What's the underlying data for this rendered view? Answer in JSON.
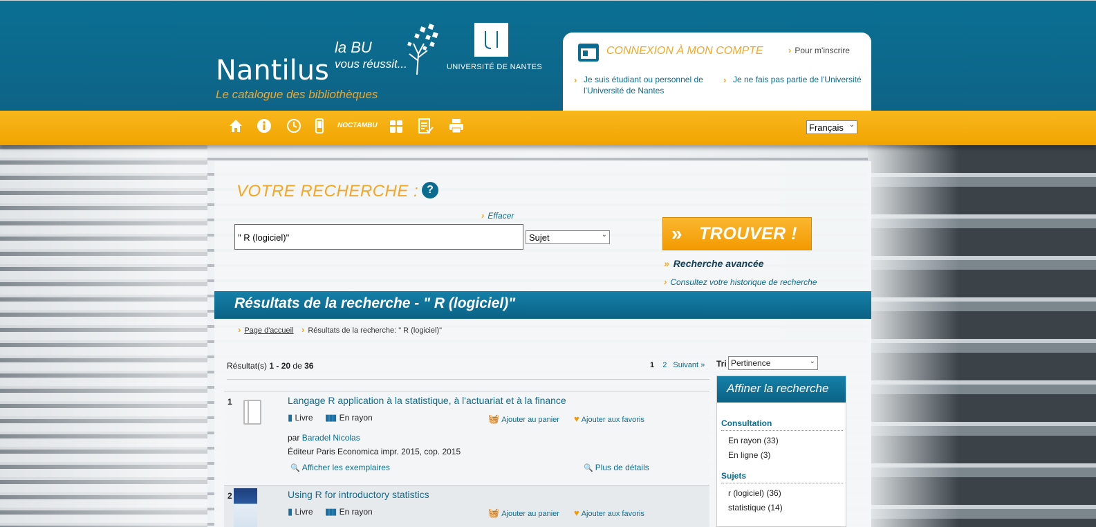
{
  "header": {
    "brand": "Nantilus",
    "tagline": "Le catalogue des bibliothèques",
    "labu_line1": "la BU",
    "labu_line2": "vous réussit...",
    "university": "UNIVERSITÉ DE NANTES",
    "account": {
      "title": "CONNEXION À MON COMPTE",
      "register": "Pour m'inscrire",
      "link_student": "Je suis étudiant ou personnel de l'Université de Nantes",
      "link_external": "Je ne fais pas partie de l'Université"
    }
  },
  "nav": {
    "icons": [
      "home-icon",
      "info-icon",
      "clock-icon",
      "mobile-icon",
      "noctambu-icon",
      "bottles-icon",
      "checklist-icon",
      "print-icon"
    ],
    "noctambu_label": "NOCTAMBU",
    "language": "Français"
  },
  "search": {
    "title": "VOTRE RECHERCHE :",
    "help": "?",
    "clear": "Effacer",
    "query": "\" R (logiciel)\"",
    "field": "Sujet",
    "find_button": "TROUVER !",
    "advanced": "Recherche avancée",
    "history": "Consultez votre historique de recherche"
  },
  "results": {
    "banner": "Résultats de la recherche - \" R (logiciel)\"",
    "breadcrumb_home": "Page d'accueil",
    "breadcrumb_current": "Résultats de la recherche: \" R (logiciel)\"",
    "count_prefix": "Résultat(s)",
    "count_range": "1 - 20",
    "count_of": "de",
    "count_total": "36",
    "pager": {
      "current": "1",
      "next_page": "2",
      "next": "Suivant »"
    },
    "sort_label": "Tri",
    "sort_value": "Pertinence",
    "items": [
      {
        "num": "1",
        "title": "Langage R application à la statistique, à l'actuariat et à la finance",
        "type": "Livre",
        "status": "En rayon",
        "add_cart": "Ajouter au panier",
        "add_fav": "Ajouter aux favoris",
        "author_prefix": "par",
        "author": "Baradel Nicolas",
        "editor": "Éditeur Paris Economica impr. 2015, cop. 2015",
        "show_copies": "Afficher les exemplaires",
        "more_details": "Plus de détails"
      },
      {
        "num": "2",
        "title": "Using R for introductory statistics",
        "type": "Livre",
        "status": "En rayon",
        "add_cart": "Ajouter au panier",
        "add_fav": "Ajouter aux favoris"
      }
    ]
  },
  "refine": {
    "title": "Affiner la recherche",
    "consultation_label": "Consultation",
    "consultation": [
      {
        "label": "En rayon",
        "count": "(33)"
      },
      {
        "label": "En ligne",
        "count": "(3)"
      }
    ],
    "subjects_label": "Sujets",
    "subjects": [
      {
        "label": "r (logiciel)",
        "count": "(36)"
      },
      {
        "label": "statistique",
        "count": "(14)"
      }
    ]
  }
}
